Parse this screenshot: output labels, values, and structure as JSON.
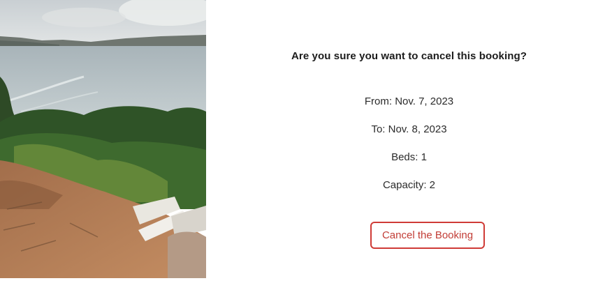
{
  "booking": {
    "confirm_title": "Are you sure you want to cancel this booking?",
    "from_text": "From: Nov. 7, 2023",
    "to_text": "To: Nov. 8, 2023",
    "beds_text": "Beds: 1",
    "capacity_text": "Capacity: 2",
    "cancel_button_label": "Cancel the Booking"
  },
  "colors": {
    "button_accent": "#cf3b36",
    "background": "#ffffff",
    "text": "#222222"
  }
}
